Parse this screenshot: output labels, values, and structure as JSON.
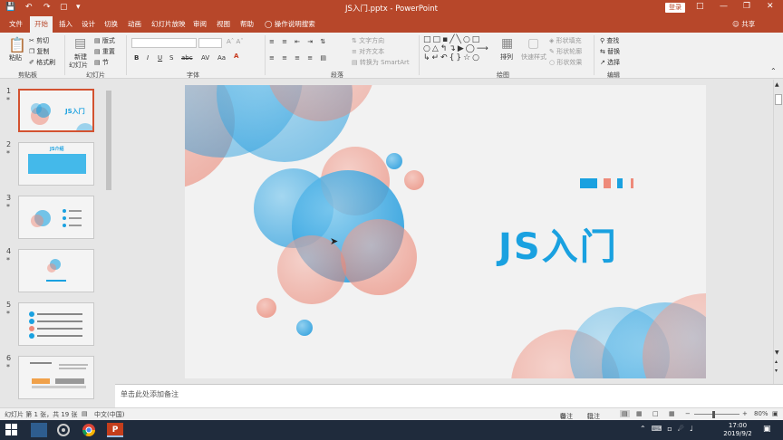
{
  "window": {
    "title": "JS入门.pptx  -  PowerPoint",
    "login_label": "登录"
  },
  "tabs": [
    {
      "label": "文件",
      "active": false
    },
    {
      "label": "开始",
      "active": true
    },
    {
      "label": "插入",
      "active": false
    },
    {
      "label": "设计",
      "active": false
    },
    {
      "label": "切换",
      "active": false
    },
    {
      "label": "动画",
      "active": false
    },
    {
      "label": "幻灯片放映",
      "active": false
    },
    {
      "label": "审阅",
      "active": false
    },
    {
      "label": "视图",
      "active": false
    },
    {
      "label": "帮助",
      "active": false
    }
  ],
  "tell_me": "操作说明搜索",
  "share": "共享",
  "ribbon": {
    "clipboard": {
      "paste": "粘贴",
      "cut": "剪切",
      "copy": "复制",
      "format_painter": "格式刷",
      "group": "剪贴板"
    },
    "slides": {
      "new_slide": "新建",
      "new_slide2": "幻灯片",
      "layout": "版式",
      "reset": "重置",
      "section": "节",
      "group": "幻灯片"
    },
    "font": {
      "group": "字体"
    },
    "paragraph": {
      "text_direction": "文字方向",
      "align_text": "对齐文本",
      "smartart": "转换为 SmartArt",
      "group": "段落"
    },
    "drawing": {
      "arrange": "排列",
      "quick_styles": "快速样式",
      "fill": "形状填充",
      "outline": "形状轮廓",
      "effects": "形状效果",
      "group": "绘图"
    },
    "editing": {
      "find": "查找",
      "replace": "替换",
      "select": "选择",
      "group": "编辑"
    }
  },
  "thumbnails": [
    {
      "num": "1",
      "star": "*",
      "title": "JS入门",
      "selected": true
    },
    {
      "num": "2",
      "star": "*",
      "title": "JS介绍",
      "selected": false
    },
    {
      "num": "3",
      "star": "*",
      "title": "",
      "selected": false
    },
    {
      "num": "4",
      "star": "*",
      "title": "",
      "selected": false
    },
    {
      "num": "5",
      "star": "*",
      "title": "",
      "selected": false
    },
    {
      "num": "6",
      "star": "*",
      "title": "",
      "selected": false
    }
  ],
  "slide": {
    "title": "JS入门",
    "accent": "#1aa1e0",
    "secondary": "#ee8a7a"
  },
  "notes_placeholder": "单击此处添加备注",
  "status": {
    "slide_info": "幻灯片 第 1 张，共 19 张",
    "language": "中文(中国)",
    "notes": "备注",
    "comments": "批注",
    "zoom": "80%"
  },
  "taskbar": {
    "time": "17:00",
    "date": "2019/9/2"
  }
}
